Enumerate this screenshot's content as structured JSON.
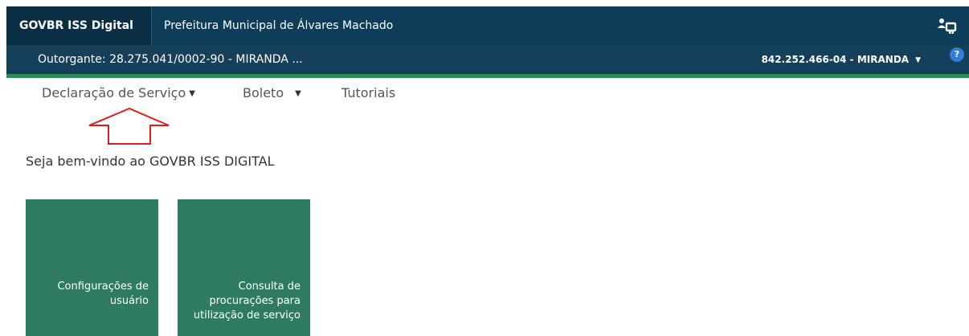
{
  "header": {
    "brand": "GOVBR ISS Digital",
    "prefeitura": "Prefeitura Municipal de Álvares Machado",
    "user_icon": "user-switch-icon"
  },
  "subheader": {
    "outorgante": "Outorgante: 28.275.041/0002-90 - MIRANDA ...",
    "user": "842.252.466-04 - MIRANDA",
    "help": "?",
    "accent_color": "#2e8b57"
  },
  "nav": {
    "items": [
      {
        "label": "Declaração de Serviço",
        "has_dropdown": true
      },
      {
        "label": "Boleto",
        "has_dropdown": true
      },
      {
        "label": "Tutoriais",
        "has_dropdown": false
      }
    ]
  },
  "annotation": {
    "shape": "red-outline-up-arrow",
    "color": "#e31b1b"
  },
  "welcome": "Seja bem-vindo ao GOVBR ISS DIGITAL",
  "tiles": [
    {
      "label": "Configurações de usuário",
      "color": "#2f7a63"
    },
    {
      "label": "Consulta de procurações para utilização de serviço",
      "color": "#2f7a63"
    }
  ]
}
